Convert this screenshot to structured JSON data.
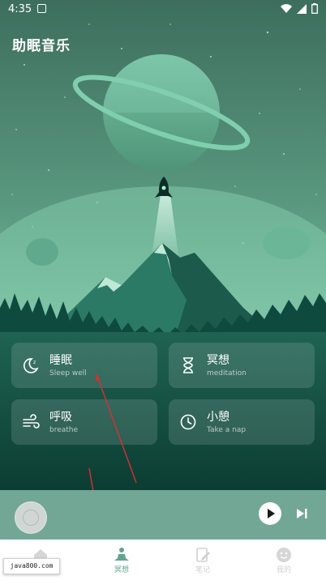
{
  "status": {
    "time": "4:35"
  },
  "app": {
    "title": "助眠音乐"
  },
  "colors": {
    "sky_top": "#3d6e5d",
    "sky_bottom": "#74bea0",
    "accent": "#5fa58d",
    "forest": "#0e4a3f",
    "player_bg": "#71a794"
  },
  "cards": [
    {
      "title": "睡眠",
      "subtitle": "Sleep well",
      "icon": "moon-icon"
    },
    {
      "title": "冥想",
      "subtitle": "meditation",
      "icon": "hourglass-icon"
    },
    {
      "title": "呼吸",
      "subtitle": "breathe",
      "icon": "wind-icon"
    },
    {
      "title": "小憩",
      "subtitle": "Take a nap",
      "icon": "clock-icon"
    }
  ],
  "player": {
    "play_icon": "play-icon",
    "next_icon": "skip-next-icon"
  },
  "tabs": [
    {
      "label": "",
      "icon": "home-icon",
      "active": false
    },
    {
      "label": "冥想",
      "icon": "meditation-person-icon",
      "active": true
    },
    {
      "label": "笔记",
      "icon": "note-edit-icon",
      "active": false
    },
    {
      "label": "我的",
      "icon": "face-icon",
      "active": false
    }
  ],
  "watermark": "java800.com"
}
